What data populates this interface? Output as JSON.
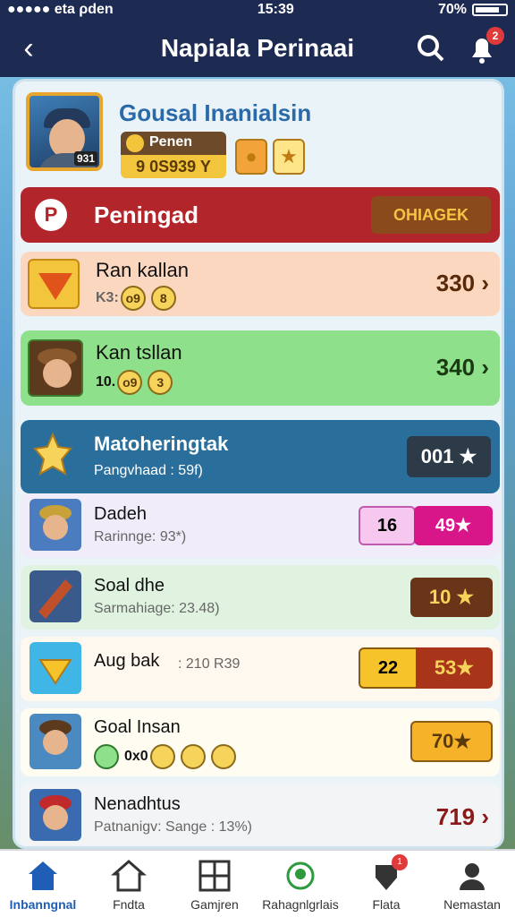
{
  "status": {
    "carrier": "●●●●● eta ρden",
    "time": "15:39",
    "battery": "70%"
  },
  "header": {
    "title": "Napiala Perinaai"
  },
  "profile": {
    "name": "Gousal Inanialsin",
    "rank_label": "Penen",
    "points": "9 0S939 Y",
    "avatar_tag": "931"
  },
  "title_row": {
    "label": "Peningad",
    "button": "OHIAGEK"
  },
  "entries": [
    {
      "name": "Ran kallan",
      "sub": "K3:",
      "chips": [
        "o9",
        "8"
      ],
      "value": "330 ›"
    },
    {
      "name": "Kan tsllan",
      "sub": "10.",
      "chips": [
        "o9",
        "3"
      ],
      "value": "340 ›"
    }
  ],
  "section": {
    "title": "Matoheringtak",
    "sub": "Pangvhaad : 59f)",
    "value": "001 ★"
  },
  "list": [
    {
      "name": "Dadeh",
      "sub": "Rarinnge: 93*)",
      "badge1": "16",
      "badge2": "49★"
    },
    {
      "name": "Soal dhe",
      "sub": "Sarmahiage: 23.48)",
      "badge2": "10 ★"
    },
    {
      "name": "Aug bak",
      "sub": ": 210 R39",
      "badge1": "22",
      "badge2": "53★"
    },
    {
      "name": "Goal Insan",
      "sub": "0x0",
      "badge2": "70★"
    },
    {
      "name": "Nenadhtus",
      "sub": "Patnanigv: Sange : 13%)",
      "value": "719 ›"
    }
  ],
  "nav": [
    {
      "label": "Inbanngnal"
    },
    {
      "label": "Fndta"
    },
    {
      "label": "Gamjren"
    },
    {
      "label": "Rahagnlgrlais"
    },
    {
      "label": "Flata"
    },
    {
      "label": "Nemastan"
    }
  ],
  "colors": {
    "header": "#1d2a52",
    "red": "#b2262b",
    "accent": "#1f5eb6"
  }
}
